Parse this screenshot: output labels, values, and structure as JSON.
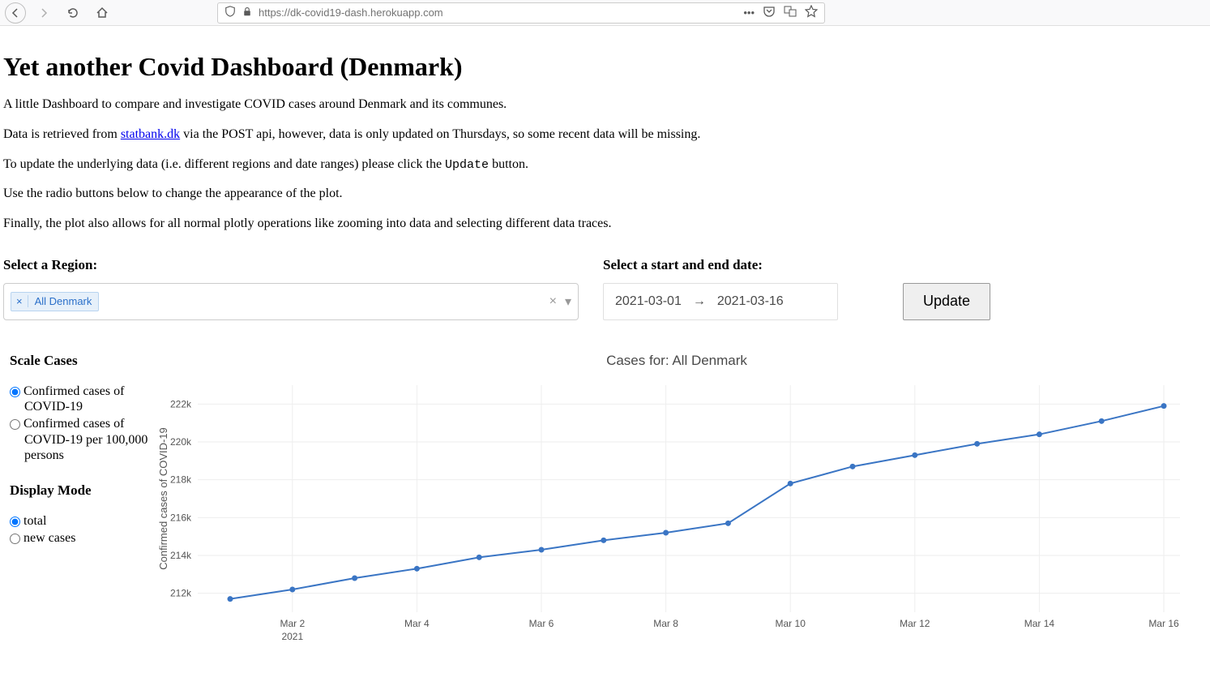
{
  "browser": {
    "url": "https://dk-covid19-dash.herokuapp.com"
  },
  "header": {
    "title": "Yet another Covid Dashboard (Denmark)"
  },
  "intro": {
    "p1": "A little Dashboard to compare and investigate COVID cases around Denmark and its communes.",
    "p2a": "Data is retrieved from ",
    "p2link": "statbank.dk",
    "p2b": " via the POST api, however, data is only updated on Thursdays, so some recent data will be missing.",
    "p3a": "To update the underlying data (i.e. different regions and date ranges) please click the ",
    "p3mono": "Update",
    "p3b": " button.",
    "p4": "Use the radio buttons below to change the appearance of the plot.",
    "p5": "Finally, the plot also allows for all normal plotly operations like zooming into data and selecting different data traces."
  },
  "controls": {
    "region_label": "Select a Region:",
    "region_chip": "All Denmark",
    "date_label": "Select a start and end date:",
    "date_start": "2021-03-01",
    "date_end": "2021-03-16",
    "update_button": "Update"
  },
  "sidebar": {
    "scale_heading": "Scale Cases",
    "scale_options": {
      "0": "Confirmed cases of COVID-19",
      "1": "Confirmed cases of COVID-19 per 100,000 persons"
    },
    "display_heading": "Display Mode",
    "display_options": {
      "0": "total",
      "1": "new cases"
    }
  },
  "chart": {
    "title": "Cases for: All Denmark"
  },
  "chart_data": {
    "type": "line",
    "title": "Cases for: All Denmark",
    "xlabel": "",
    "ylabel": "Confirmed cases of COVID-19",
    "x": [
      "Mar 1",
      "Mar 2",
      "Mar 3",
      "Mar 4",
      "Mar 5",
      "Mar 6",
      "Mar 7",
      "Mar 8",
      "Mar 9",
      "Mar 10",
      "Mar 11",
      "Mar 12",
      "Mar 13",
      "Mar 14",
      "Mar 15",
      "Mar 16"
    ],
    "x_ticks": [
      "Mar 2",
      "Mar 4",
      "Mar 6",
      "Mar 8",
      "Mar 10",
      "Mar 12",
      "Mar 14",
      "Mar 16"
    ],
    "x_year": "2021",
    "y_ticks": [
      212000,
      214000,
      216000,
      218000,
      220000,
      222000
    ],
    "y_tick_labels": [
      "212k",
      "214k",
      "216k",
      "218k",
      "220k",
      "222k"
    ],
    "ylim": [
      211000,
      223000
    ],
    "series": [
      {
        "name": "All Denmark",
        "values": [
          211700,
          212200,
          212800,
          213300,
          213900,
          214300,
          214800,
          215200,
          215700,
          217800,
          218700,
          219300,
          219900,
          220400,
          221100,
          221900
        ]
      }
    ]
  }
}
